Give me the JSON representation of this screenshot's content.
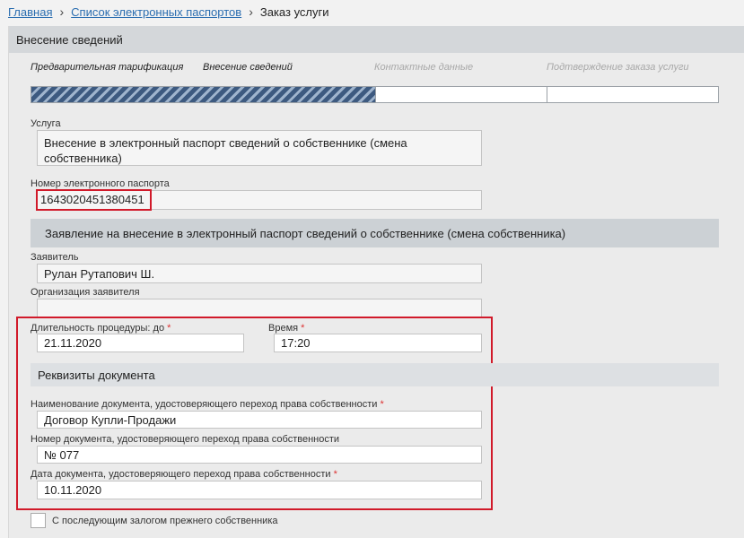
{
  "breadcrumb": {
    "home": "Главная",
    "list": "Список электронных паспортов",
    "current": "Заказ услуги",
    "separator": "›"
  },
  "panel": {
    "title": "Внесение сведений"
  },
  "steps": [
    {
      "label": "Предварительная тарификация",
      "state": "done"
    },
    {
      "label": "Внесение сведений",
      "state": "current"
    },
    {
      "label": "Контактные данные",
      "state": "pending"
    },
    {
      "label": "Подтверждение заказа услуги",
      "state": "pending"
    }
  ],
  "progress": {
    "completed_fraction": 0.5
  },
  "service": {
    "label": "Услуга",
    "value_line1": "Внесение в электронный паспорт сведений о собственнике (смена",
    "value_line2": "собственника)"
  },
  "passport": {
    "label": "Номер электронного паспорта",
    "value": "164302045138045‌1"
  },
  "application_section": {
    "title": "Заявление на внесение в электронный паспорт сведений о собственнике (смена собственника)"
  },
  "applicant": {
    "label": "Заявитель",
    "value": "Рулан Рутапович Ш."
  },
  "organization": {
    "label": "Организация заявителя",
    "value": ""
  },
  "duration": {
    "label": "Длительность процедуры: до",
    "required_mark": "*",
    "value": "21.11.2020"
  },
  "time": {
    "label": "Время",
    "required_mark": "*",
    "value": "17:20"
  },
  "doc_section": {
    "title": "Реквизиты документа"
  },
  "doc_name": {
    "label": "Наименование документа, удостоверяющего переход права собственности",
    "required_mark": "*",
    "value": "Договор Купли-Продажи"
  },
  "doc_number": {
    "label": "Номер документа, удостоверяющего переход права собственности",
    "value": "№ 077"
  },
  "doc_date": {
    "label": "Дата документа, удостоверяющего переход права собственности",
    "required_mark": "*",
    "value": "10.11.2020"
  },
  "pledge_checkbox": {
    "label": "С последующим залогом прежнего собственника",
    "checked": false
  },
  "colors": {
    "highlight": "#d11a2a",
    "link": "#2a6db0",
    "progress": "#3d5a80"
  }
}
